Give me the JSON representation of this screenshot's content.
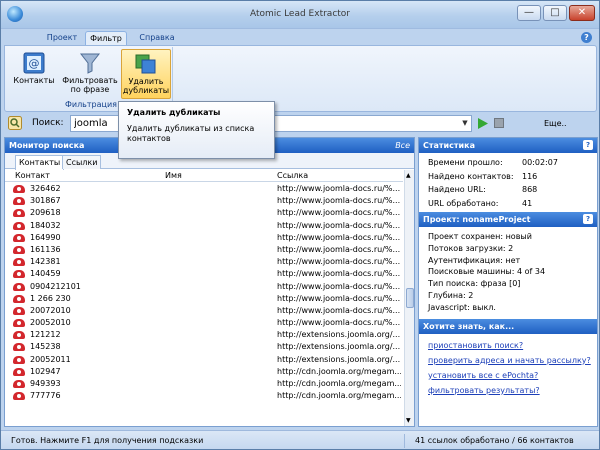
{
  "window": {
    "title": "Atomic Lead Extractor",
    "min_glyph": "—",
    "max_glyph": "□",
    "close_glyph": "✕"
  },
  "ribbon": {
    "tabs": [
      "Проект",
      "Фильтр",
      "Справка"
    ],
    "active_tab": "Фильтр",
    "buttons": {
      "contacts_label": "Контакты",
      "filter_label_1": "Фильтровать",
      "filter_label_2": "по фразе",
      "dedup_label_1": "Удалить",
      "dedup_label_2": "дубликаты"
    },
    "group_label": "Фильтрация"
  },
  "tooltip": {
    "title": "Удалить дубликаты",
    "text": "Удалить дубликаты из списка контактов"
  },
  "search": {
    "label": "Поиск:",
    "value": "joomla",
    "more_label": "Еще.."
  },
  "monitor": {
    "title": "Монитор поиска",
    "all_label": "Все",
    "tabs": [
      "Контакты",
      "Ссылки"
    ],
    "columns": [
      "Контакт",
      "Имя",
      "Ссылка"
    ],
    "rows": [
      {
        "contact": "326462",
        "name": "",
        "link": "http://www.joomla-docs.ru/%..."
      },
      {
        "contact": "301867",
        "name": "",
        "link": "http://www.joomla-docs.ru/%..."
      },
      {
        "contact": "209618",
        "name": "",
        "link": "http://www.joomla-docs.ru/%..."
      },
      {
        "contact": "184032",
        "name": "",
        "link": "http://www.joomla-docs.ru/%..."
      },
      {
        "contact": "164990",
        "name": "",
        "link": "http://www.joomla-docs.ru/%..."
      },
      {
        "contact": "161136",
        "name": "",
        "link": "http://www.joomla-docs.ru/%..."
      },
      {
        "contact": "142381",
        "name": "",
        "link": "http://www.joomla-docs.ru/%..."
      },
      {
        "contact": "140459",
        "name": "",
        "link": "http://www.joomla-docs.ru/%..."
      },
      {
        "contact": "0904212101",
        "name": "",
        "link": "http://www.joomla-docs.ru/%..."
      },
      {
        "contact": "1 266 230",
        "name": "",
        "link": "http://www.joomla-docs.ru/%..."
      },
      {
        "contact": "20072010",
        "name": "",
        "link": "http://www.joomla-docs.ru/%..."
      },
      {
        "contact": "20052010",
        "name": "",
        "link": "http://www.joomla-docs.ru/%..."
      },
      {
        "contact": "121212",
        "name": "",
        "link": "http://extensions.joomla.org/..."
      },
      {
        "contact": "145238",
        "name": "",
        "link": "http://extensions.joomla.org/..."
      },
      {
        "contact": "20052011",
        "name": "",
        "link": "http://extensions.joomla.org/..."
      },
      {
        "contact": "102947",
        "name": "",
        "link": "http://cdn.joomla.org/megam..."
      },
      {
        "contact": "949393",
        "name": "",
        "link": "http://cdn.joomla.org/megam..."
      },
      {
        "contact": "777776",
        "name": "",
        "link": "http://cdn.joomla.org/megam..."
      }
    ]
  },
  "stats": {
    "title": "Статистика",
    "items": [
      {
        "label": "Времени прошло:",
        "value": "00:02:07"
      },
      {
        "label": "Найдено контактов:",
        "value": "116"
      },
      {
        "label": "Найдено URL:",
        "value": "868"
      },
      {
        "label": "URL обработано:",
        "value": "41"
      }
    ]
  },
  "project": {
    "title": "Проект: nonameProject",
    "lines": [
      "Проект сохранен: новый",
      "Потоков загрузки: 2",
      "Аутентификация: нет",
      "Поисковые машины: 4 of 34",
      "Тип поиска: фраза [0]",
      "Глубина: 2",
      "Javascript: выкл."
    ]
  },
  "howto": {
    "title": "Хотите знать, как...",
    "links": [
      "приостановить поиск?",
      "проверить адреса и начать рассылку?",
      "установить все с ePochta?",
      "фильтровать результаты?"
    ]
  },
  "status": {
    "left": "Готов. Нажмите F1 для получения подсказки",
    "right": "41 ссылок обработано / 66 контактов"
  },
  "colors": {
    "panel_header": "#1f5fc2",
    "link": "#1c3fb8",
    "accent_highlight": "#ffd35e"
  }
}
